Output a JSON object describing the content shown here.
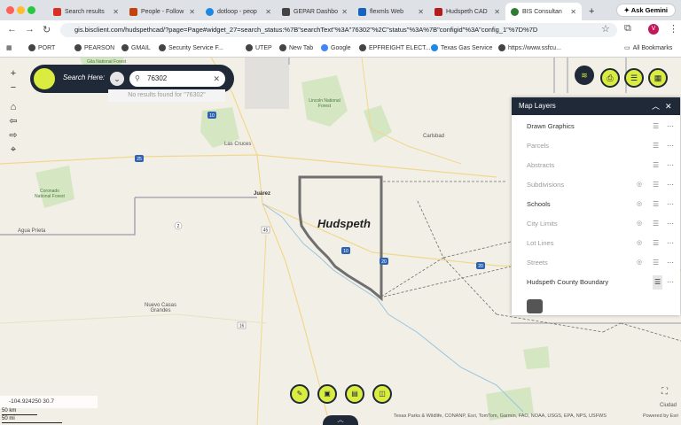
{
  "browser": {
    "tabs": [
      {
        "label": "Search results",
        "color": "#d93025"
      },
      {
        "label": "People - Follow",
        "color": "#c2410c"
      },
      {
        "label": "dotloop - peop",
        "color": "#1e88e5"
      },
      {
        "label": "GEPAR Dashbo",
        "color": "#444444"
      },
      {
        "label": "flexmls Web",
        "color": "#1565c0"
      },
      {
        "label": "Hudspeth CAD",
        "color": "#b71c1c"
      },
      {
        "label": "BIS Consultan",
        "color": "#2e7d32"
      }
    ],
    "new_tab": "+",
    "ask_gemini": "Ask Gemini",
    "url": "gis.bisclient.com/hudspethcad/?page=Page#widget_27=search_status:%7B\"searchText\"%3A\"76302\"%2C\"status\"%3A%7B\"configid\"%3A\"config_1\"%7D%7D",
    "bookmarks": [
      "PORT",
      "PEARSON",
      "GMAIL",
      "Security Service F...",
      "UTEP",
      "New Tab",
      "Google",
      "EPFREIGHT ELECT...",
      "Texas Gas Service",
      "https://www.ssfcu..."
    ],
    "all_bookmarks": "All Bookmarks"
  },
  "search": {
    "label": "Search Here:",
    "value": "76302",
    "no_result": "No results found for \"76302\""
  },
  "map": {
    "county_label": "Hudspeth",
    "places": [
      "Las Cruces",
      "Lincoln National Forest",
      "Carlsbad",
      "Juárez",
      "Agua Prieta",
      "Coronado National Forest",
      "Gila National Forest",
      "Nuevo Casas Grandes",
      "Ciudad"
    ],
    "route_shields": [
      "10",
      "25",
      "45",
      "2",
      "16",
      "10",
      "20"
    ],
    "coordinates": "-104.924250 30.7",
    "scale_km": "50 km",
    "scale_mi": "50 mi",
    "attribution": "Texas Parks & Wildlife, CONANP, Esri, TomTom, Garmin, FAO, NOAA, USGS, EPA, NPS, USFWS",
    "powered_by": "Powered by Esri"
  },
  "layers_panel": {
    "title": "Map Layers",
    "items": [
      {
        "label": "Drawn Graphics",
        "visible": true,
        "eye": false
      },
      {
        "label": "Parcels",
        "visible": false,
        "eye": false
      },
      {
        "label": "Abstracts",
        "visible": false,
        "eye": false
      },
      {
        "label": "Subdivisions",
        "visible": false,
        "eye": true
      },
      {
        "label": "Schools",
        "visible": true,
        "eye": true
      },
      {
        "label": "City Limits",
        "visible": false,
        "eye": true
      },
      {
        "label": "Lot Lines",
        "visible": false,
        "eye": true
      },
      {
        "label": "Streets",
        "visible": false,
        "eye": true
      },
      {
        "label": "Hudspeth County Boundary",
        "visible": true,
        "eye": false
      }
    ]
  },
  "colors": {
    "accent": "#d9ec3f",
    "dark": "#1f2937"
  }
}
